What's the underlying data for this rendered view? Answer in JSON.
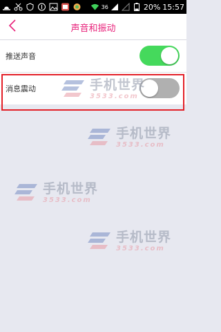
{
  "status_bar": {
    "network_label": "36",
    "battery_percent": "20%",
    "time": "15:57",
    "left_icons": [
      "sunrise-icon",
      "scissor-icon",
      "shield-icon",
      "number-icon",
      "image-icon",
      "app-icon",
      "color-icon"
    ]
  },
  "nav": {
    "title": "声音和振动",
    "back_icon": "chevron-left-icon"
  },
  "settings": [
    {
      "label": "推送声音",
      "enabled": true
    },
    {
      "label": "消息震动",
      "enabled": false
    }
  ],
  "watermark": {
    "main": "手机世界",
    "sub": "3533.com"
  },
  "colors": {
    "accent": "#e8217a",
    "toggle_on": "#45d95c",
    "toggle_off": "#b0b0b0",
    "highlight": "#e31f27"
  }
}
